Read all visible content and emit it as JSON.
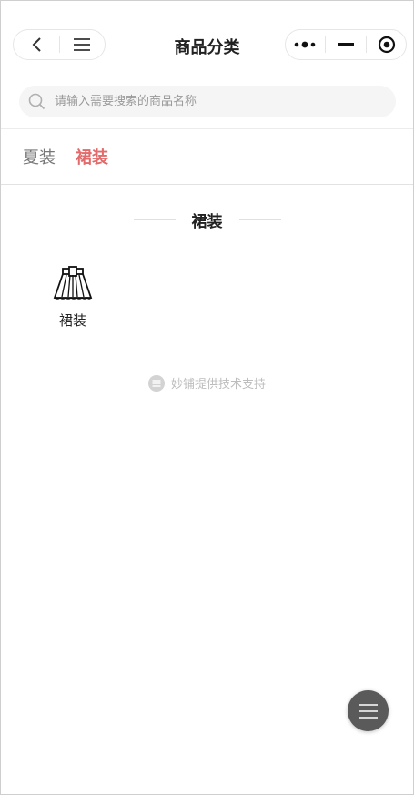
{
  "header": {
    "title": "商品分类",
    "left_capsule": {
      "back_icon": "chevron-left-icon",
      "menu_icon": "hamburger-menu-icon"
    },
    "right_capsule": {
      "more_icon": "more-dots-icon",
      "minimize_icon": "minimize-icon",
      "close_icon": "target-close-icon"
    }
  },
  "search": {
    "placeholder": "请输入需要搜索的商品名称",
    "value": ""
  },
  "tabs": [
    {
      "label": "夏装",
      "active": false
    },
    {
      "label": "裙装",
      "active": true
    }
  ],
  "section": {
    "title": "裙装"
  },
  "categories": [
    {
      "label": "裙装",
      "icon": "skirt-icon"
    }
  ],
  "footer": {
    "support_text": "妙铺提供技术支持",
    "icon": "miaopu-logo-icon"
  },
  "fab": {
    "icon": "hamburger-menu-icon"
  },
  "colors": {
    "accent": "#e26a6a",
    "fab": "#5a5a5a"
  }
}
